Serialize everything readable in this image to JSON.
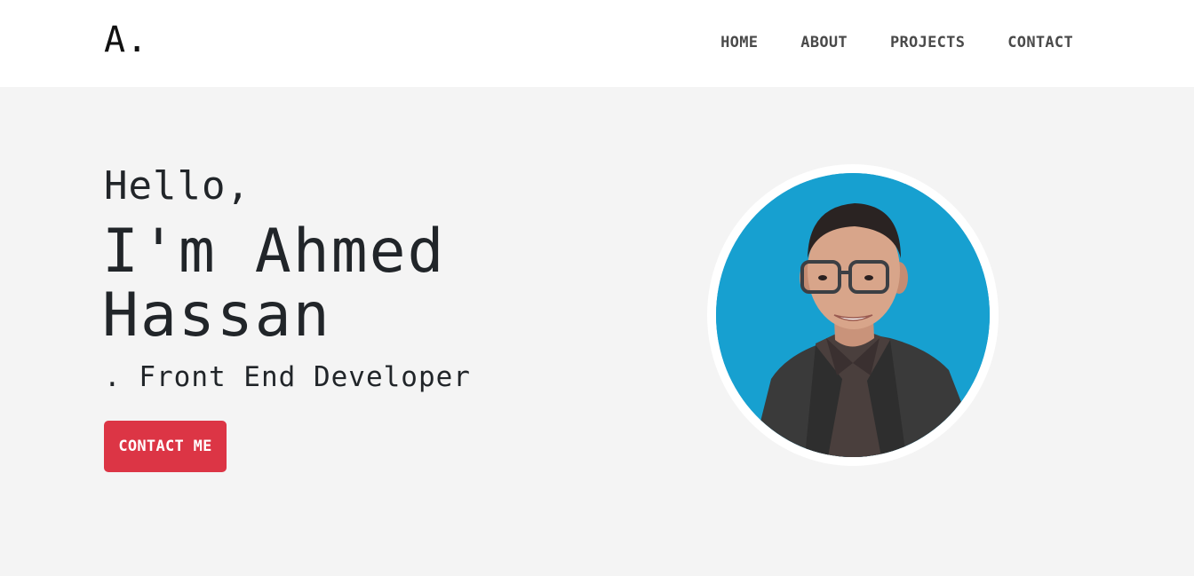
{
  "nav": {
    "logo": "A.",
    "links": [
      {
        "label": "HOME"
      },
      {
        "label": "ABOUT"
      },
      {
        "label": "PROJECTS"
      },
      {
        "label": "CONTACT"
      }
    ]
  },
  "hero": {
    "greeting": "Hello,",
    "name": "I'm Ahmed Hassan",
    "role": ". Front End Developer",
    "cta_label": "CONTACT ME"
  },
  "colors": {
    "accent": "#dc3545",
    "photo_bg": "#17a0d0",
    "hero_bg": "#f4f4f4"
  },
  "icons": {
    "profile_photo": "person-portrait"
  }
}
